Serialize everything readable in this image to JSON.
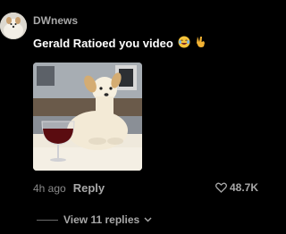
{
  "comment": {
    "username": "DWnews",
    "text": "Gerald Ratioed you video",
    "emojis": [
      "laughing-face-icon",
      "victory-hand-icon"
    ],
    "media_description_icon": "dog-with-wine-image",
    "timestamp": "4h ago",
    "reply_label": "Reply",
    "like_count": "48.7K",
    "view_replies_label": "View 11 replies"
  },
  "colors": {
    "background": "#000000",
    "username": "#a8a8a8",
    "text": "#ffffff",
    "muted": "#8a8a8a"
  }
}
